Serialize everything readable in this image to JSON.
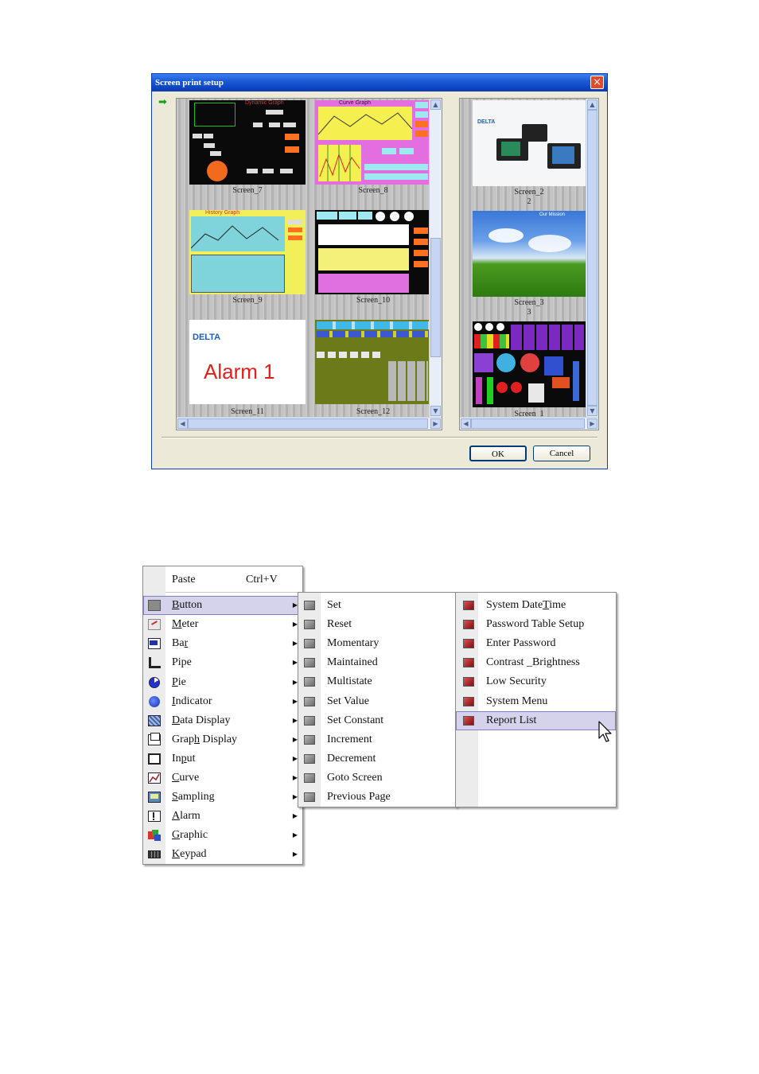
{
  "dialog": {
    "title": "Screen print setup",
    "close_symbol": "×",
    "ok_label": "OK",
    "cancel_label": "Cancel",
    "left_screens": [
      {
        "label": "Screen_7"
      },
      {
        "label": "Screen_8"
      },
      {
        "label": "Screen_9"
      },
      {
        "label": "Screen_10"
      },
      {
        "label": "Screen_11"
      },
      {
        "label": "Screen_12"
      }
    ],
    "right_screens": [
      {
        "label": "Screen_2",
        "number": "2"
      },
      {
        "label": "Screen_3",
        "number": "3"
      },
      {
        "label": "Screen_1"
      }
    ],
    "thumb_text": {
      "s7_title": "Dynamic Graph",
      "s8_title": "Curve Graph",
      "s9_title": "History Graph",
      "s11_brand": "DELTA",
      "s11_text": "Alarm 1",
      "s2_brand": "DELTA",
      "s3_title": "Our Mission"
    }
  },
  "menu": {
    "main": [
      {
        "label": "Paste",
        "shortcut": "Ctrl+V",
        "icon": "none"
      },
      {
        "label": "Button",
        "u": 0,
        "icon": "button-icon",
        "submenu": true,
        "highlight": true
      },
      {
        "label": "Meter",
        "u": 0,
        "icon": "meter-icon",
        "submenu": true
      },
      {
        "label": "Bar",
        "u": 2,
        "icon": "bar-icon",
        "submenu": true
      },
      {
        "label": "Pipe",
        "u": -1,
        "icon": "pipe-icon",
        "submenu": true
      },
      {
        "label": "Pie",
        "u": 0,
        "icon": "pie-icon",
        "submenu": true
      },
      {
        "label": "Indicator",
        "u": 0,
        "icon": "indicator-icon",
        "submenu": true
      },
      {
        "label": "Data Display",
        "u": 0,
        "icon": "data-display-icon",
        "submenu": true
      },
      {
        "label": "Graph Display",
        "u": 4,
        "icon": "graph-display-icon",
        "submenu": true
      },
      {
        "label": "Input",
        "u": 2,
        "icon": "input-icon",
        "submenu": true
      },
      {
        "label": "Curve",
        "u": 0,
        "icon": "curve-icon",
        "submenu": true
      },
      {
        "label": "Sampling",
        "u": 0,
        "icon": "sampling-icon",
        "submenu": true
      },
      {
        "label": "Alarm",
        "u": 0,
        "icon": "alarm-icon",
        "submenu": true
      },
      {
        "label": "Graphic",
        "u": 0,
        "icon": "graphic-icon",
        "submenu": true
      },
      {
        "label": "Keypad",
        "u": 0,
        "icon": "keypad-icon",
        "submenu": true
      }
    ],
    "button_sub": [
      {
        "label": "Set"
      },
      {
        "label": "Reset"
      },
      {
        "label": "Momentary"
      },
      {
        "label": "Maintained"
      },
      {
        "label": "Multistate"
      },
      {
        "label": "Set Value"
      },
      {
        "label": "Set Constant"
      },
      {
        "label": "Increment"
      },
      {
        "label": "Decrement"
      },
      {
        "label": "Goto Screen"
      },
      {
        "label": "Previous Page"
      }
    ],
    "function_sub": [
      {
        "label": "System DateTime",
        "u": 11
      },
      {
        "label": "Password Table Setup"
      },
      {
        "label": "Enter Password"
      },
      {
        "label": "Contrast _Brightness"
      },
      {
        "label": "Low Security"
      },
      {
        "label": "System Menu"
      },
      {
        "label": "Report List",
        "highlight": true
      }
    ]
  },
  "colors": {
    "title_blue": "#0b44c3",
    "menu_highlight": "#d5d3ec",
    "dialog_bg": "#ece9d8"
  }
}
